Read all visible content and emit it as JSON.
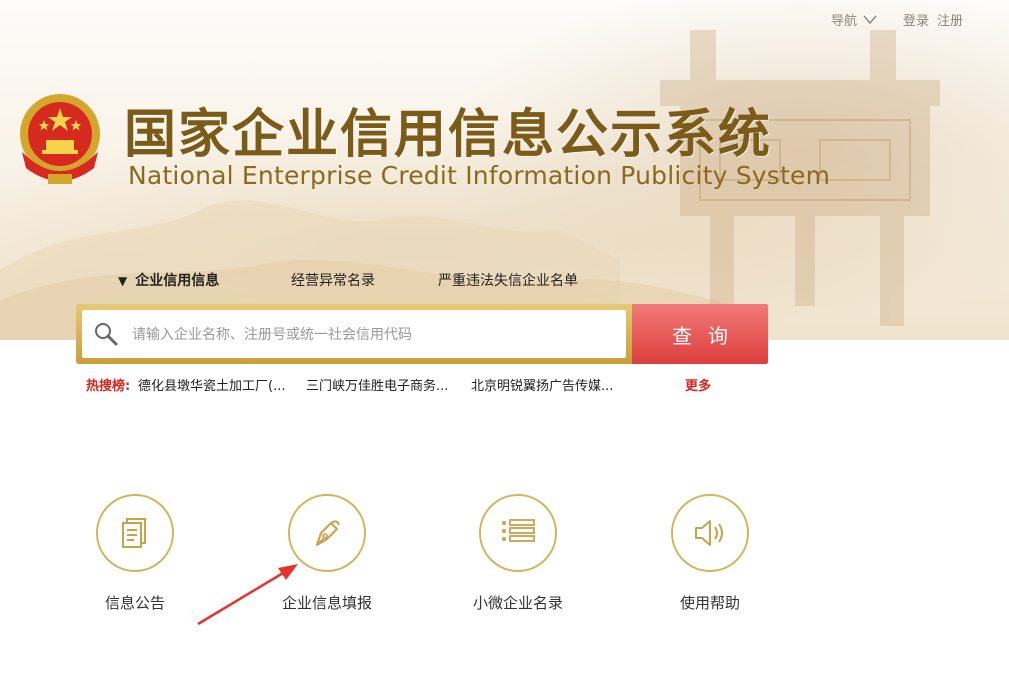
{
  "top_nav": {
    "guide_label": "导航",
    "login_label": "登录",
    "register_label": "注册"
  },
  "logo": {
    "title_cn": "国家企业信用信息公示系统",
    "title_en": "National Enterprise Credit Information Publicity System"
  },
  "search_tabs": [
    {
      "label": "企业信用信息",
      "active": true
    },
    {
      "label": "经营异常名录",
      "active": false
    },
    {
      "label": "严重违法失信企业名单",
      "active": false
    }
  ],
  "search": {
    "placeholder": "请输入企业名称、注册号或统一社会信用代码",
    "value": "",
    "button_label": "查询"
  },
  "hot_searches": {
    "label": "热搜榜:",
    "items": [
      "德化县墩华瓷土加工厂(...",
      "三门峡万佳胜电子商务...",
      "北京明锐翼扬广告传媒..."
    ],
    "more_label": "更多"
  },
  "features": [
    {
      "label": "信息公告",
      "icon": "document-icon"
    },
    {
      "label": "企业信息填报",
      "icon": "pen-nib-icon"
    },
    {
      "label": "小微企业名录",
      "icon": "list-icon"
    },
    {
      "label": "使用帮助",
      "icon": "speaker-icon"
    }
  ],
  "colors": {
    "gold": "#d6b35b",
    "brand_brown": "#7a5b18",
    "search_red": "#e04a48",
    "hot_red": "#d9261c"
  }
}
